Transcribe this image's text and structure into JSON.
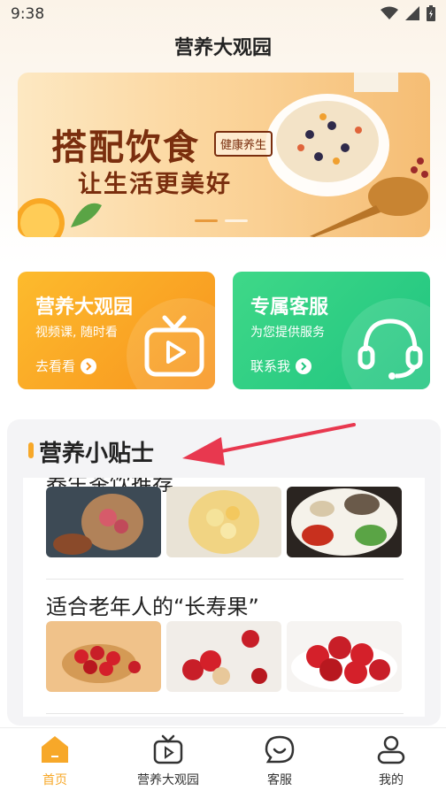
{
  "status": {
    "time": "9:38"
  },
  "header": {
    "title": "营养大观园"
  },
  "banner": {
    "headline": "搭配饮食",
    "tag": "健康养生",
    "subline": "让生活更美好",
    "dot_count": 2,
    "active_dot": 0
  },
  "cards": [
    {
      "title": "营养大观园",
      "subtitle": "视频课, 随时看",
      "link": "去看看",
      "icon": "tv-icon",
      "color": "#f7941e"
    },
    {
      "title": "专属客服",
      "subtitle": "为您提供服务",
      "link": "联系我",
      "icon": "headset-icon",
      "color": "#1fc480"
    }
  ],
  "tips": {
    "title": "营养小贴士",
    "articles": [
      {
        "title": "养生茶饮推荐",
        "photos": [
          "rose-tea-photo",
          "chrysanthemum-tea-photo",
          "herbal-ingredients-photo"
        ]
      },
      {
        "title": "适合老年人的“长寿果”",
        "photos": [
          "hawthorn-bowl-photo",
          "hawthorn-sliced-photo",
          "hawthorn-pile-photo"
        ]
      }
    ]
  },
  "bottom_nav": [
    {
      "label": "首页",
      "icon": "home-icon",
      "active": true
    },
    {
      "label": "营养大观园",
      "icon": "tv-icon",
      "active": false
    },
    {
      "label": "客服",
      "icon": "chat-icon",
      "active": false
    },
    {
      "label": "我的",
      "icon": "user-icon",
      "active": false
    }
  ],
  "colors": {
    "accent": "#f7a829",
    "orange": "#f7941e",
    "green": "#1fc480",
    "banner_text": "#7a2e0e",
    "annotation": "#e8384f"
  }
}
